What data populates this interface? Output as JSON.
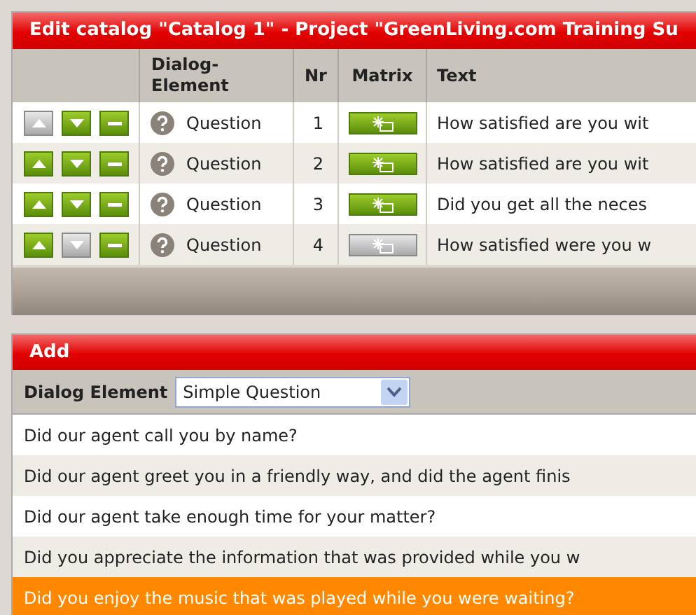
{
  "catalog_panel": {
    "title": "Edit catalog \"Catalog 1\" - Project \"GreenLiving.com Training Su",
    "columns": [
      "Dialog-\nElement",
      "Nr",
      "Matrix",
      "Text"
    ],
    "rows": [
      {
        "up_disabled": true,
        "down_disabled": false,
        "element": "Question",
        "nr": "1",
        "matrix_enabled": true,
        "text": "How satisfied are you wit"
      },
      {
        "up_disabled": false,
        "down_disabled": false,
        "element": "Question",
        "nr": "2",
        "matrix_enabled": true,
        "text": "How satisfied are you wit"
      },
      {
        "up_disabled": false,
        "down_disabled": false,
        "element": "Question",
        "nr": "3",
        "matrix_enabled": true,
        "text": "Did you get all the neces"
      },
      {
        "up_disabled": false,
        "down_disabled": true,
        "element": "Question",
        "nr": "4",
        "matrix_enabled": false,
        "text": "How satisfied were you w"
      }
    ]
  },
  "add_panel": {
    "title": "Add",
    "dialog_element_label": "Dialog Element",
    "dialog_element_value": "Simple Question",
    "items": [
      {
        "text": "Did our agent call you by name?",
        "selected": false
      },
      {
        "text": "Did our agent greet you in a friendly way, and did the agent finis",
        "selected": false
      },
      {
        "text": "Did our agent take enough time for your matter?",
        "selected": false
      },
      {
        "text": "Did you appreciate the information that was provided while you w",
        "selected": false
      },
      {
        "text": "Did you enjoy the music that was played while you were waiting?",
        "selected": true
      }
    ]
  }
}
